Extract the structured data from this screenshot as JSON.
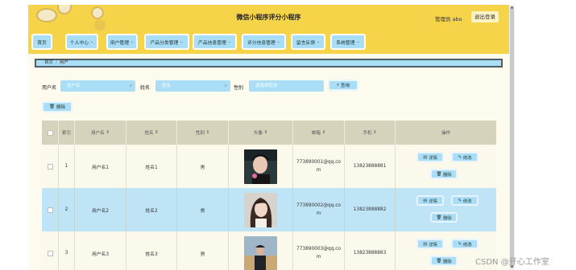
{
  "header": {
    "title": "微信小程序评分小程序",
    "admin_label": "管理员 abo",
    "logout_label": "退出登录",
    "bg_color": "#f6d44a"
  },
  "nav": {
    "items": [
      {
        "label": "首页",
        "has_caret": false
      },
      {
        "label": "个人中心",
        "has_caret": true
      },
      {
        "label": "用户管理",
        "has_caret": true
      },
      {
        "label": "产品分类管理",
        "has_caret": true
      },
      {
        "label": "产品信息管理",
        "has_caret": true
      },
      {
        "label": "评分信息管理",
        "has_caret": true
      },
      {
        "label": "留言反馈",
        "has_caret": true
      },
      {
        "label": "系统管理",
        "has_caret": true
      }
    ],
    "caret": "⌄"
  },
  "breadcrumb": {
    "home": "首页",
    "separator": "/",
    "current": "用户"
  },
  "search": {
    "username_label": "用户名",
    "username_placeholder": "用户名",
    "name_label": "姓名",
    "name_placeholder": "姓名",
    "gender_label": "性别",
    "gender_placeholder": "请选择性别",
    "query_label": "查询",
    "query_icon": "search-icon"
  },
  "actions": {
    "delete_label": "删除",
    "delete_icon": "trash-icon"
  },
  "table": {
    "columns": [
      {
        "label": "",
        "sortable": false
      },
      {
        "label": "索引",
        "sortable": false
      },
      {
        "label": "用户名",
        "sortable": true
      },
      {
        "label": "姓名",
        "sortable": true
      },
      {
        "label": "性别",
        "sortable": true
      },
      {
        "label": "头像",
        "sortable": true
      },
      {
        "label": "邮箱",
        "sortable": true
      },
      {
        "label": "手机",
        "sortable": true
      },
      {
        "label": "操作",
        "sortable": false
      }
    ],
    "sort_glyph": "⇕",
    "rows": [
      {
        "index": "1",
        "username": "用户名1",
        "name": "姓名1",
        "gender": "男",
        "email": "773890001@qq.com",
        "phone": "13823888881"
      },
      {
        "index": "2",
        "username": "用户名2",
        "name": "姓名2",
        "gender": "男",
        "email": "773890002@qq.com",
        "phone": "13823888882"
      },
      {
        "index": "3",
        "username": "用户名3",
        "name": "姓名3",
        "gender": "男",
        "email": "773890003@qq.com",
        "phone": "13823888883"
      }
    ],
    "row_actions": {
      "detail_label": "详情",
      "edit_label": "修改",
      "delete_label": "删除"
    }
  },
  "watermark": "CSDN @开心工作室"
}
